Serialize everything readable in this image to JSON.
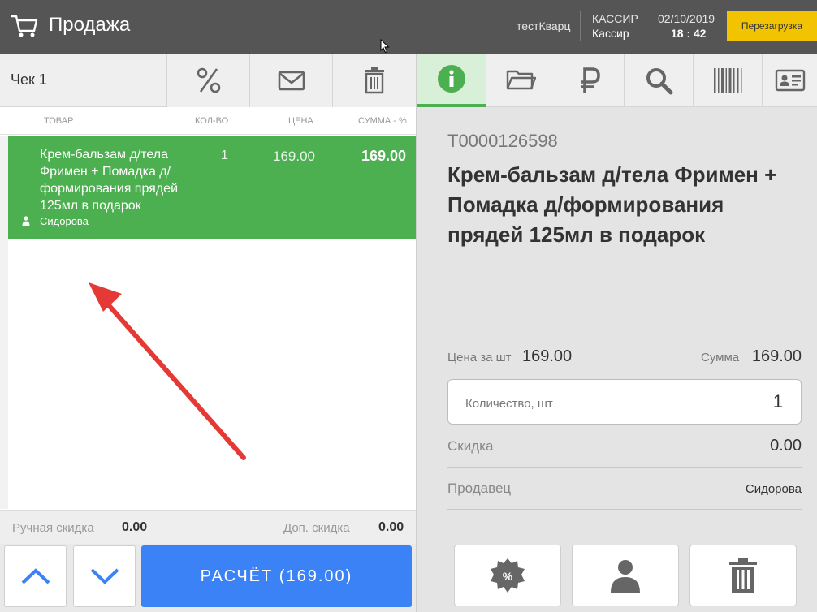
{
  "header": {
    "title": "Продажа",
    "icon": "cart-icon",
    "store": "тестКварц",
    "cashier_role": "КАССИР",
    "cashier_name": "Кассир",
    "date": "02/10/2019",
    "time": "18 : 42",
    "reload_label": "Перезагрузка",
    "reload_color": "#f2c300"
  },
  "receipt": {
    "title": "Чек 1",
    "toolbar": [
      {
        "icon": "percent-icon"
      },
      {
        "icon": "envelope-icon"
      },
      {
        "icon": "trash-icon"
      }
    ],
    "columns": {
      "product": "ТОВАР",
      "qty": "КОЛ-ВО",
      "price": "ЦЕНА",
      "sum": "СУММА - %"
    },
    "items": [
      {
        "name": "Крем-бальзам д/тела Фримен + Помадка д/формирования прядей 125мл в подарок",
        "qty": "1",
        "price": "169.00",
        "sum": "169.00",
        "seller": "Сидорова",
        "selected": true
      }
    ],
    "manual_discount_label": "Ручная скидка",
    "manual_discount_value": "0.00",
    "extra_discount_label": "Доп. скидка",
    "extra_discount_value": "0.00",
    "pay_label": "РАСЧЁТ (169.00)",
    "accent_color": "#4caf50",
    "pay_color": "#3b82f6"
  },
  "tabs": [
    {
      "icon": "info-icon",
      "active": true
    },
    {
      "icon": "folder-icon"
    },
    {
      "icon": "ruble-icon"
    },
    {
      "icon": "search-icon"
    },
    {
      "icon": "barcode-icon"
    },
    {
      "icon": "id-card-icon"
    }
  ],
  "details": {
    "code": "T0000126598",
    "name": "Крем-бальзам д/тела Фримен + Помадка д/формирования прядей 125мл в подарок",
    "unit_price_label": "Цена за шт",
    "unit_price": "169.00",
    "sum_label": "Сумма",
    "sum": "169.00",
    "qty_label": "Количество, шт",
    "qty": "1",
    "discount_label": "Скидка",
    "discount": "0.00",
    "seller_label": "Продавец",
    "seller": "Сидорова"
  },
  "actions": [
    {
      "icon": "discount-badge-icon"
    },
    {
      "icon": "user-icon"
    },
    {
      "icon": "trash-icon"
    }
  ]
}
